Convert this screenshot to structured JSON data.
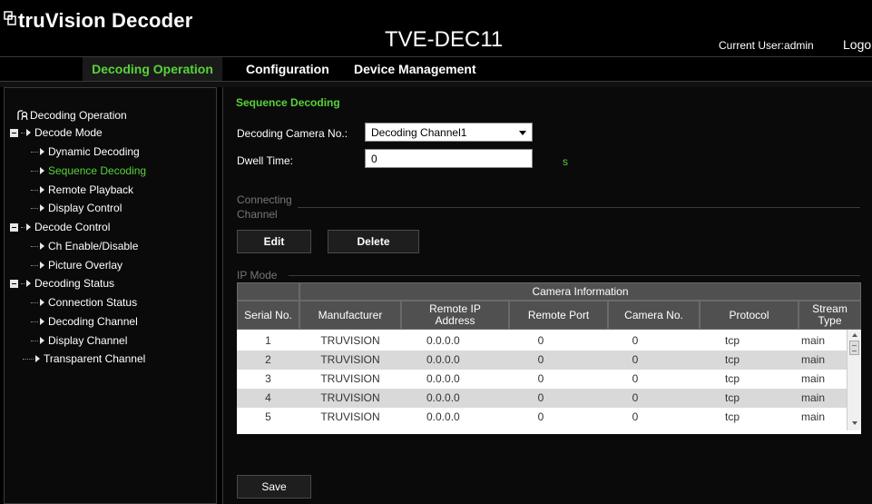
{
  "header": {
    "app_title": "truVision Decoder",
    "device_name": "TVE-DEC11",
    "current_user": "Current User:admin",
    "logout_label": "Logout"
  },
  "nav": {
    "tabs": [
      {
        "label": "Decoding Operation",
        "active": true
      },
      {
        "label": "Configuration",
        "active": false
      },
      {
        "label": "Device Management",
        "active": false
      }
    ]
  },
  "sidebar": {
    "root": "Decoding Operation",
    "items": [
      {
        "label": "Decode Mode"
      },
      {
        "label": "Dynamic Decoding"
      },
      {
        "label": "Sequence Decoding",
        "active": true
      },
      {
        "label": "Remote Playback"
      },
      {
        "label": "Display Control"
      },
      {
        "label": "Decode Control"
      },
      {
        "label": "Ch Enable/Disable"
      },
      {
        "label": "Picture Overlay"
      },
      {
        "label": "Decoding Status"
      },
      {
        "label": "Connection Status"
      },
      {
        "label": "Decoding Channel"
      },
      {
        "label": "Display Channel"
      },
      {
        "label": "Transparent Channel"
      }
    ]
  },
  "main": {
    "section_title": "Sequence Decoding",
    "camera_no_label": "Decoding Camera No.:",
    "camera_no_value": "Decoding Channel1",
    "dwell_time_label": "Dwell Time:",
    "dwell_time_value": "0",
    "dwell_time_unit": "s",
    "connecting_group_line1": "Connecting",
    "connecting_group_line2": "Channel",
    "edit_label": "Edit",
    "delete_label": "Delete",
    "ip_mode_label": "IP Mode",
    "save_label": "Save"
  },
  "table": {
    "group_header": "Camera Information",
    "headers": {
      "serial": "Serial No.",
      "manufacturer": "Manufacturer",
      "remote_ip_1": "Remote IP",
      "remote_ip_2": "Address",
      "remote_port": "Remote Port",
      "camera_no": "Camera No.",
      "protocol": "Protocol",
      "stream_1": "Stream",
      "stream_2": "Type"
    },
    "rows": [
      {
        "serial": "1",
        "manufacturer": "TRUVISION",
        "ip": "0.0.0.0",
        "port": "0",
        "camera": "0",
        "protocol": "tcp",
        "stream": "main"
      },
      {
        "serial": "2",
        "manufacturer": "TRUVISION",
        "ip": "0.0.0.0",
        "port": "0",
        "camera": "0",
        "protocol": "tcp",
        "stream": "main"
      },
      {
        "serial": "3",
        "manufacturer": "TRUVISION",
        "ip": "0.0.0.0",
        "port": "0",
        "camera": "0",
        "protocol": "tcp",
        "stream": "main"
      },
      {
        "serial": "4",
        "manufacturer": "TRUVISION",
        "ip": "0.0.0.0",
        "port": "0",
        "camera": "0",
        "protocol": "tcp",
        "stream": "main"
      },
      {
        "serial": "5",
        "manufacturer": "TRUVISION",
        "ip": "0.0.0.0",
        "port": "0",
        "camera": "0",
        "protocol": "tcp",
        "stream": "main"
      }
    ]
  },
  "colors": {
    "accent": "#57d339",
    "background": "#000000",
    "table_header": "#505050",
    "row_alt": "#d9d9d9"
  }
}
